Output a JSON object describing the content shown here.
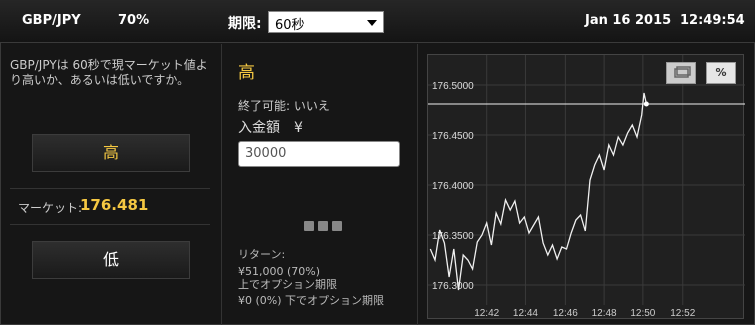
{
  "topbar": {
    "pair": "GBP/JPY",
    "payout": "70%",
    "expiry_label": "期限:",
    "expiry_value": "60秒",
    "date": "Jan 16 2015",
    "time": "12:49:54"
  },
  "left": {
    "question": "GBP/JPYは 60秒で現マーケット値より高いか、あるいは低いですか。",
    "high_label": "高",
    "market_label": "マーケット:",
    "market_value": "176.481",
    "low_label": "低"
  },
  "middle": {
    "direction": "高",
    "close_available": "終了可能: いいえ",
    "amount_label": "入金額　¥",
    "amount_value": "30000",
    "return_label": "リターン:",
    "return_win": "¥51,000 (70%)",
    "return_win_desc": "上でオプション期限",
    "return_lose": "¥0 (0%) 下でオプション期限"
  },
  "chart_data": {
    "type": "line",
    "x_ticks": [
      "12:42",
      "12:44",
      "12:46",
      "12:48",
      "12:50",
      "12:52"
    ],
    "y_ticks": [
      "176.5000",
      "176.4500",
      "176.4000",
      "176.3500",
      "176.3000"
    ],
    "ylim": [
      176.28,
      176.53
    ],
    "xlim": [
      12.65,
      12.92
    ],
    "current_value": 176.481,
    "series": [
      {
        "values": [
          [
            12.652,
            176.336
          ],
          [
            12.656,
            176.325
          ],
          [
            12.66,
            176.355
          ],
          [
            12.664,
            176.342
          ],
          [
            12.668,
            176.308
          ],
          [
            12.672,
            176.336
          ],
          [
            12.676,
            176.295
          ],
          [
            12.68,
            176.33
          ],
          [
            12.684,
            176.325
          ],
          [
            12.688,
            176.316
          ],
          [
            12.692,
            176.343
          ],
          [
            12.696,
            176.35
          ],
          [
            12.7,
            176.362
          ],
          [
            12.704,
            176.34
          ],
          [
            12.708,
            176.372
          ],
          [
            12.712,
            176.361
          ],
          [
            12.716,
            176.385
          ],
          [
            12.72,
            176.375
          ],
          [
            12.724,
            176.384
          ],
          [
            12.728,
            176.362
          ],
          [
            12.732,
            176.368
          ],
          [
            12.736,
            176.352
          ],
          [
            12.74,
            176.36
          ],
          [
            12.744,
            176.368
          ],
          [
            12.748,
            176.342
          ],
          [
            12.752,
            176.33
          ],
          [
            12.756,
            176.34
          ],
          [
            12.76,
            176.326
          ],
          [
            12.764,
            176.338
          ],
          [
            12.768,
            176.336
          ],
          [
            12.772,
            176.352
          ],
          [
            12.776,
            176.365
          ],
          [
            12.78,
            176.37
          ],
          [
            12.784,
            176.354
          ],
          [
            12.788,
            176.405
          ],
          [
            12.792,
            176.42
          ],
          [
            12.796,
            176.43
          ],
          [
            12.8,
            176.415
          ],
          [
            12.804,
            176.44
          ],
          [
            12.808,
            176.43
          ],
          [
            12.812,
            176.448
          ],
          [
            12.816,
            176.44
          ],
          [
            12.82,
            176.452
          ],
          [
            12.824,
            176.46
          ],
          [
            12.828,
            176.448
          ],
          [
            12.832,
            176.47
          ],
          [
            12.834,
            176.492
          ],
          [
            12.836,
            176.481
          ]
        ]
      }
    ]
  }
}
